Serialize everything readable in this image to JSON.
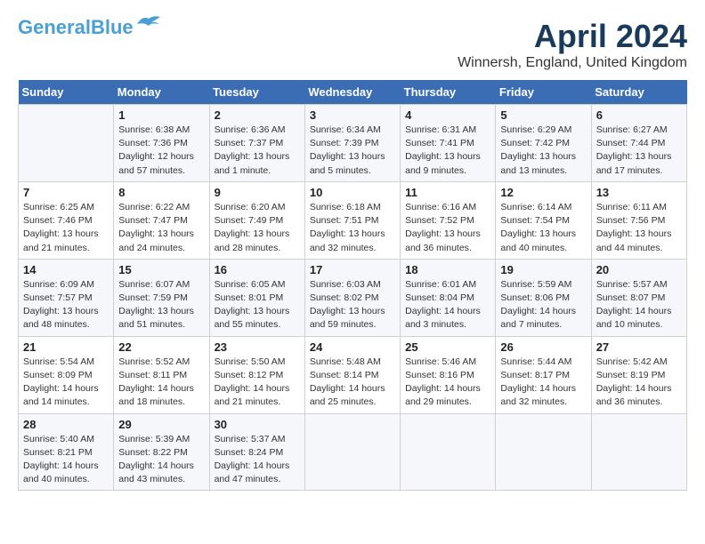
{
  "header": {
    "logo_line1": "General",
    "logo_line2": "Blue",
    "month": "April 2024",
    "location": "Winnersh, England, United Kingdom"
  },
  "weekdays": [
    "Sunday",
    "Monday",
    "Tuesday",
    "Wednesday",
    "Thursday",
    "Friday",
    "Saturday"
  ],
  "weeks": [
    [
      {
        "day": "",
        "text": ""
      },
      {
        "day": "1",
        "text": "Sunrise: 6:38 AM\nSunset: 7:36 PM\nDaylight: 12 hours\nand 57 minutes."
      },
      {
        "day": "2",
        "text": "Sunrise: 6:36 AM\nSunset: 7:37 PM\nDaylight: 13 hours\nand 1 minute."
      },
      {
        "day": "3",
        "text": "Sunrise: 6:34 AM\nSunset: 7:39 PM\nDaylight: 13 hours\nand 5 minutes."
      },
      {
        "day": "4",
        "text": "Sunrise: 6:31 AM\nSunset: 7:41 PM\nDaylight: 13 hours\nand 9 minutes."
      },
      {
        "day": "5",
        "text": "Sunrise: 6:29 AM\nSunset: 7:42 PM\nDaylight: 13 hours\nand 13 minutes."
      },
      {
        "day": "6",
        "text": "Sunrise: 6:27 AM\nSunset: 7:44 PM\nDaylight: 13 hours\nand 17 minutes."
      }
    ],
    [
      {
        "day": "7",
        "text": "Sunrise: 6:25 AM\nSunset: 7:46 PM\nDaylight: 13 hours\nand 21 minutes."
      },
      {
        "day": "8",
        "text": "Sunrise: 6:22 AM\nSunset: 7:47 PM\nDaylight: 13 hours\nand 24 minutes."
      },
      {
        "day": "9",
        "text": "Sunrise: 6:20 AM\nSunset: 7:49 PM\nDaylight: 13 hours\nand 28 minutes."
      },
      {
        "day": "10",
        "text": "Sunrise: 6:18 AM\nSunset: 7:51 PM\nDaylight: 13 hours\nand 32 minutes."
      },
      {
        "day": "11",
        "text": "Sunrise: 6:16 AM\nSunset: 7:52 PM\nDaylight: 13 hours\nand 36 minutes."
      },
      {
        "day": "12",
        "text": "Sunrise: 6:14 AM\nSunset: 7:54 PM\nDaylight: 13 hours\nand 40 minutes."
      },
      {
        "day": "13",
        "text": "Sunrise: 6:11 AM\nSunset: 7:56 PM\nDaylight: 13 hours\nand 44 minutes."
      }
    ],
    [
      {
        "day": "14",
        "text": "Sunrise: 6:09 AM\nSunset: 7:57 PM\nDaylight: 13 hours\nand 48 minutes."
      },
      {
        "day": "15",
        "text": "Sunrise: 6:07 AM\nSunset: 7:59 PM\nDaylight: 13 hours\nand 51 minutes."
      },
      {
        "day": "16",
        "text": "Sunrise: 6:05 AM\nSunset: 8:01 PM\nDaylight: 13 hours\nand 55 minutes."
      },
      {
        "day": "17",
        "text": "Sunrise: 6:03 AM\nSunset: 8:02 PM\nDaylight: 13 hours\nand 59 minutes."
      },
      {
        "day": "18",
        "text": "Sunrise: 6:01 AM\nSunset: 8:04 PM\nDaylight: 14 hours\nand 3 minutes."
      },
      {
        "day": "19",
        "text": "Sunrise: 5:59 AM\nSunset: 8:06 PM\nDaylight: 14 hours\nand 7 minutes."
      },
      {
        "day": "20",
        "text": "Sunrise: 5:57 AM\nSunset: 8:07 PM\nDaylight: 14 hours\nand 10 minutes."
      }
    ],
    [
      {
        "day": "21",
        "text": "Sunrise: 5:54 AM\nSunset: 8:09 PM\nDaylight: 14 hours\nand 14 minutes."
      },
      {
        "day": "22",
        "text": "Sunrise: 5:52 AM\nSunset: 8:11 PM\nDaylight: 14 hours\nand 18 minutes."
      },
      {
        "day": "23",
        "text": "Sunrise: 5:50 AM\nSunset: 8:12 PM\nDaylight: 14 hours\nand 21 minutes."
      },
      {
        "day": "24",
        "text": "Sunrise: 5:48 AM\nSunset: 8:14 PM\nDaylight: 14 hours\nand 25 minutes."
      },
      {
        "day": "25",
        "text": "Sunrise: 5:46 AM\nSunset: 8:16 PM\nDaylight: 14 hours\nand 29 minutes."
      },
      {
        "day": "26",
        "text": "Sunrise: 5:44 AM\nSunset: 8:17 PM\nDaylight: 14 hours\nand 32 minutes."
      },
      {
        "day": "27",
        "text": "Sunrise: 5:42 AM\nSunset: 8:19 PM\nDaylight: 14 hours\nand 36 minutes."
      }
    ],
    [
      {
        "day": "28",
        "text": "Sunrise: 5:40 AM\nSunset: 8:21 PM\nDaylight: 14 hours\nand 40 minutes."
      },
      {
        "day": "29",
        "text": "Sunrise: 5:39 AM\nSunset: 8:22 PM\nDaylight: 14 hours\nand 43 minutes."
      },
      {
        "day": "30",
        "text": "Sunrise: 5:37 AM\nSunset: 8:24 PM\nDaylight: 14 hours\nand 47 minutes."
      },
      {
        "day": "",
        "text": ""
      },
      {
        "day": "",
        "text": ""
      },
      {
        "day": "",
        "text": ""
      },
      {
        "day": "",
        "text": ""
      }
    ]
  ]
}
